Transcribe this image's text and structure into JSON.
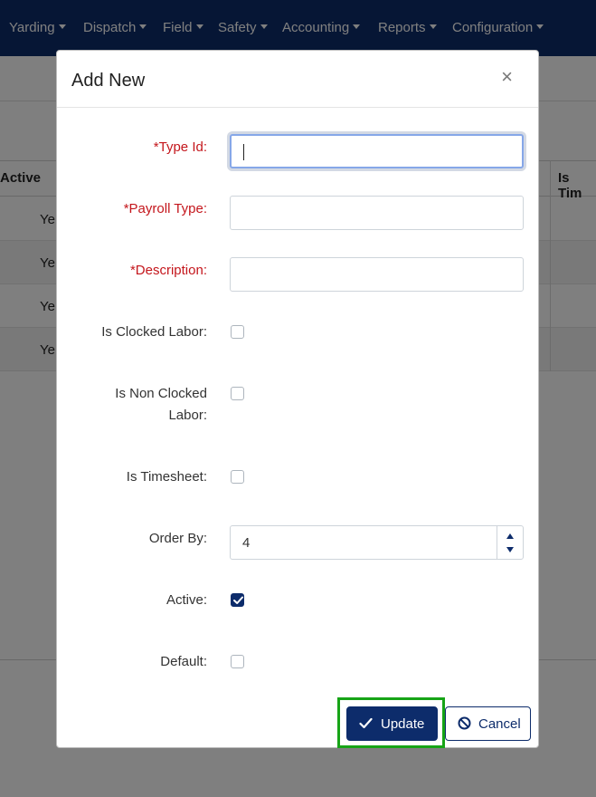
{
  "nav": {
    "items": [
      "Yarding",
      "Dispatch",
      "Field",
      "Safety",
      "Accounting",
      "Reports",
      "Configuration"
    ]
  },
  "table": {
    "headers": {
      "active": "Active",
      "is_timesheet": "Is Tim"
    },
    "rows": [
      {
        "active": "Ye"
      },
      {
        "active": "Ye"
      },
      {
        "active": "Ye"
      },
      {
        "active": "Ye"
      }
    ]
  },
  "modal": {
    "title": "Add New",
    "close_symbol": "×",
    "fields": {
      "type_id": {
        "label": "*Type Id:",
        "value": ""
      },
      "payroll_type": {
        "label": "*Payroll Type:",
        "value": ""
      },
      "description": {
        "label": "*Description:",
        "value": ""
      },
      "is_clocked_labor": {
        "label": "Is Clocked Labor:",
        "checked": false
      },
      "is_non_clocked_labor": {
        "label_line1": "Is Non Clocked",
        "label_line2": "Labor:",
        "checked": false
      },
      "is_timesheet": {
        "label": "Is Timesheet:",
        "checked": false
      },
      "order_by": {
        "label": "Order By:",
        "value": "4"
      },
      "active": {
        "label": "Active:",
        "checked": true
      },
      "default": {
        "label": "Default:",
        "checked": false
      }
    },
    "buttons": {
      "update_label": "Update",
      "cancel_label": "Cancel"
    }
  },
  "colors": {
    "navbar": "#0d2c6b",
    "primary": "#0d2c6b",
    "required": "#c4161c",
    "highlight": "#17a417"
  }
}
